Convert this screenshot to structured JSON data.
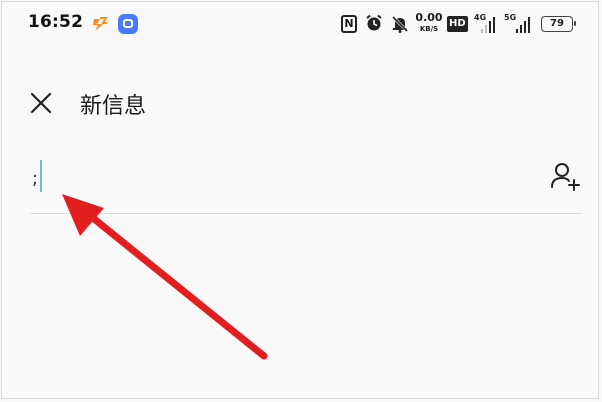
{
  "status_bar": {
    "time": "16:52",
    "nfc_label": "N",
    "net_speed_value": "0.00",
    "net_speed_unit": "KB/S",
    "hd_label": "HD",
    "signal_1_label": "4G",
    "signal_2_label": "5G",
    "battery": "79"
  },
  "header": {
    "title": "新信息"
  },
  "recipient": {
    "value": ";"
  },
  "colors": {
    "caret": "#5ec7c0",
    "annotation_arrow": "#e31e1e",
    "app_blue": "#4a7bff",
    "app_orange": "#ff8a1f"
  },
  "icons": {
    "close": "close-icon",
    "add_contact": "add-contact-icon",
    "alarm": "alarm-icon",
    "mute": "mute-icon"
  }
}
